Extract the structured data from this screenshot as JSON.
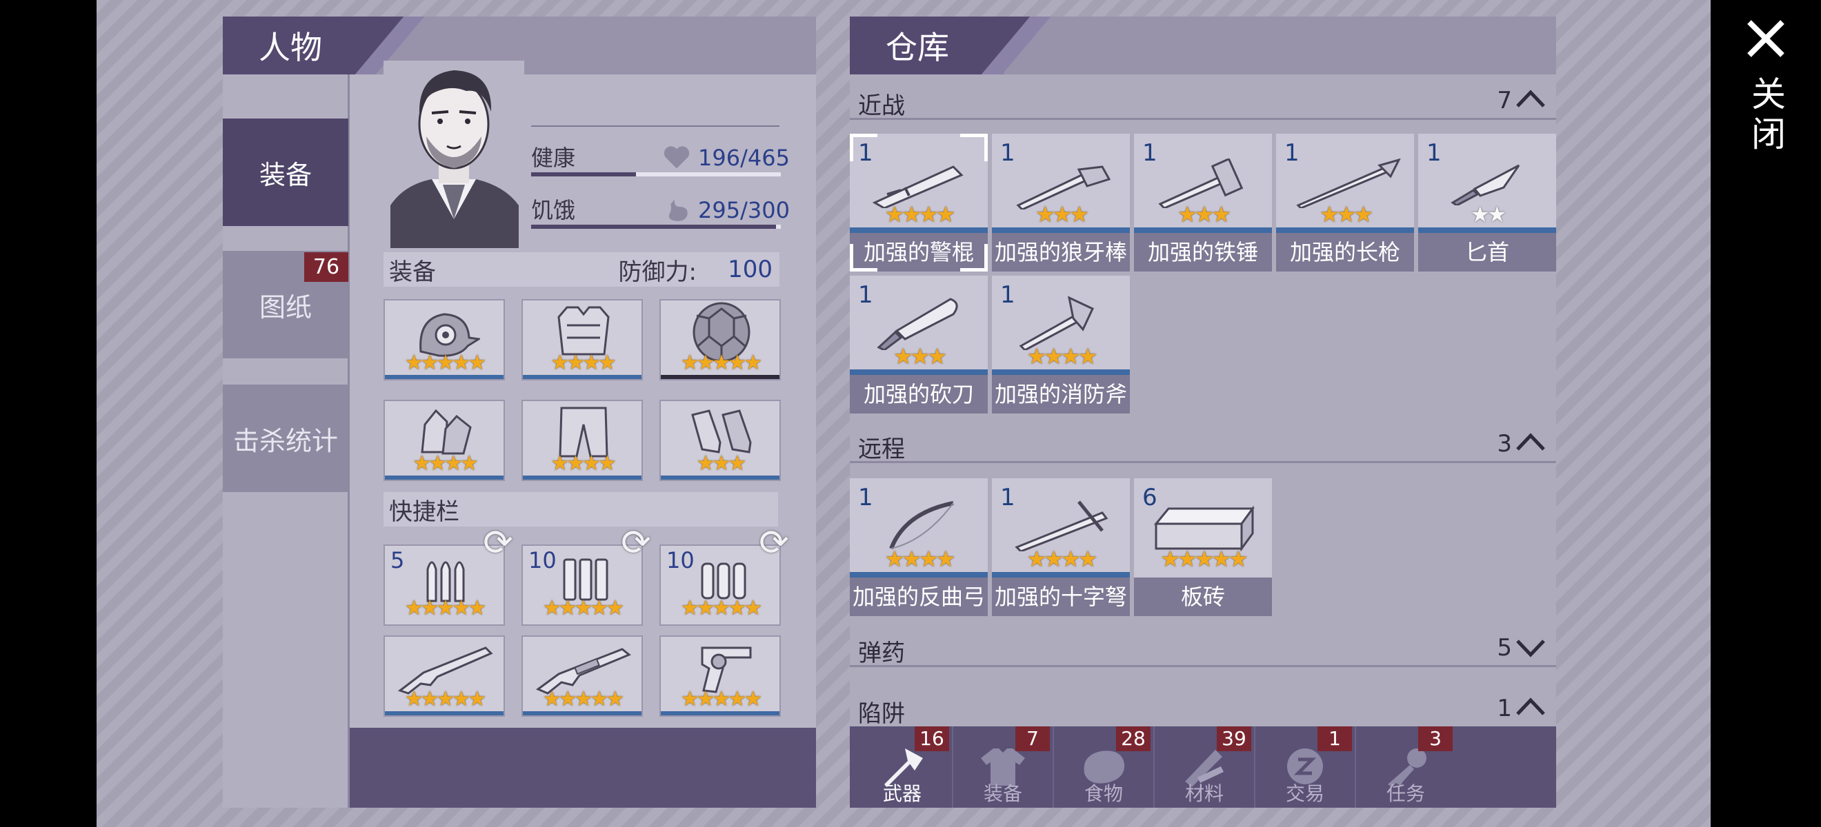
{
  "character": {
    "title": "人物",
    "nav": [
      {
        "label": "装备",
        "active": true
      },
      {
        "label": "图纸",
        "badge": "76"
      },
      {
        "label": "击杀统计"
      }
    ],
    "stats": {
      "health_label": "健康",
      "health_value": "196/465",
      "health_ratio": 0.42,
      "hunger_label": "饥饿",
      "hunger_value": "295/300",
      "hunger_ratio": 0.98
    },
    "equipment": {
      "label": "装备",
      "defense_label": "防御力:",
      "defense_value": "100"
    },
    "equip_slots": [
      {
        "icon": "bird-mask-icon",
        "stars": "★★★★★"
      },
      {
        "icon": "armor-vest-icon",
        "stars": "★★★★"
      },
      {
        "icon": "turtle-shell-icon",
        "stars": "★★★★★"
      },
      {
        "icon": "gloves-icon",
        "stars": "★★★★"
      },
      {
        "icon": "pants-icon",
        "stars": "★★★★"
      },
      {
        "icon": "boots-icon",
        "stars": "★★★"
      }
    ],
    "quickbar_label": "快捷栏",
    "quick_slots": [
      {
        "icon": "bullets-icon",
        "qty": "5",
        "stars": "★★★★★"
      },
      {
        "icon": "shotgun-shells-icon",
        "qty": "10",
        "stars": "★★★★★"
      },
      {
        "icon": "shells-icon",
        "qty": "10",
        "stars": "★★★★★"
      },
      {
        "icon": "rifle-icon",
        "stars": "★★★★★"
      },
      {
        "icon": "shotgun-icon",
        "stars": "★★★★★"
      },
      {
        "icon": "revolver-icon",
        "stars": "★★★★★"
      }
    ]
  },
  "warehouse": {
    "title": "仓库",
    "categories": [
      {
        "name": "近战",
        "count": "7",
        "expanded": true
      },
      {
        "name": "远程",
        "count": "3",
        "expanded": true
      },
      {
        "name": "弹药",
        "count": "5",
        "expanded": false
      },
      {
        "name": "陷阱",
        "count": "1",
        "expanded": true
      }
    ],
    "melee": [
      {
        "icon": "baton-icon",
        "qty": "1",
        "stars": "★★★★",
        "name": "加强的警棍",
        "selected": true
      },
      {
        "icon": "spiked-club-icon",
        "qty": "1",
        "stars": "★★★",
        "name": "加强的狼牙棒"
      },
      {
        "icon": "hammer-icon",
        "qty": "1",
        "stars": "★★★",
        "name": "加强的铁锤"
      },
      {
        "icon": "spear-icon",
        "qty": "1",
        "stars": "★★★",
        "name": "加强的长枪"
      },
      {
        "icon": "dagger-icon",
        "qty": "1",
        "stars": "★★",
        "name": "匕首",
        "white": true
      },
      {
        "icon": "machete-icon",
        "qty": "1",
        "stars": "★★★",
        "name": "加强的砍刀"
      },
      {
        "icon": "fire-axe-icon",
        "qty": "1",
        "stars": "★★★★",
        "name": "加强的消防斧"
      }
    ],
    "ranged": [
      {
        "icon": "bow-icon",
        "qty": "1",
        "stars": "★★★★",
        "name": "加强的反曲弓"
      },
      {
        "icon": "crossbow-icon",
        "qty": "1",
        "stars": "★★★★",
        "name": "加强的十字弩"
      },
      {
        "icon": "brick-icon",
        "qty": "6",
        "stars": "★★★★★",
        "name": "板砖"
      }
    ]
  },
  "tabs": [
    {
      "label": "武器",
      "count": "16",
      "icon": "axe-icon"
    },
    {
      "label": "装备",
      "count": "7",
      "icon": "shirt-icon"
    },
    {
      "label": "食物",
      "count": "28",
      "icon": "meat-icon"
    },
    {
      "label": "材料",
      "count": "39",
      "icon": "wood-icon"
    },
    {
      "label": "交易",
      "count": "1",
      "icon": "coin-icon"
    },
    {
      "label": "任务",
      "count": "3",
      "icon": "key-icon"
    }
  ],
  "close_label": "关闭",
  "colors": {
    "accent": "#544a70",
    "star": "#f2a91c",
    "badge": "#7a2630",
    "qty": "#1f3f7e"
  }
}
